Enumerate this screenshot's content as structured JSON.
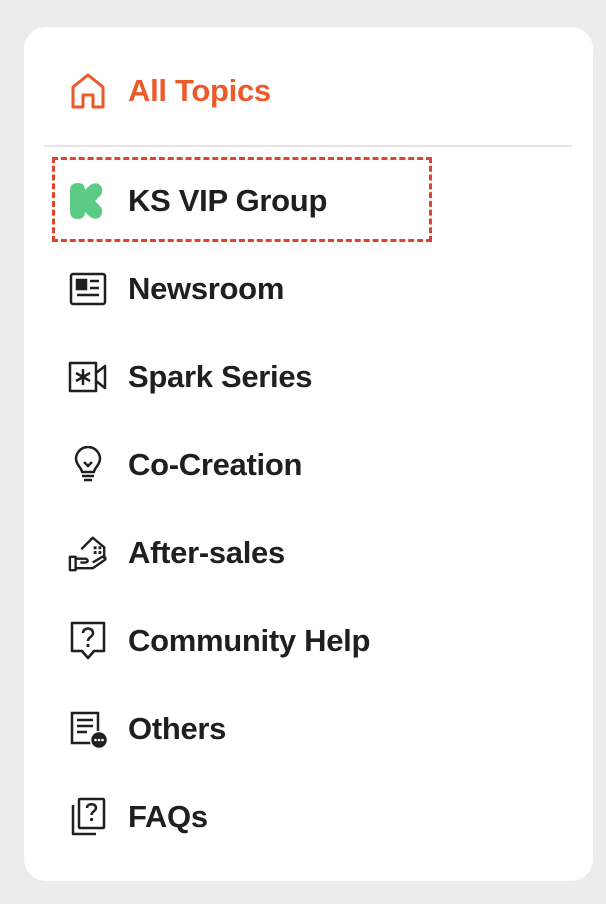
{
  "menu": {
    "all_topics": {
      "label": "All Topics",
      "icon": "home-icon",
      "color": "#ec5a2a"
    },
    "items": [
      {
        "label": "KS VIP Group",
        "icon": "ks-logo-icon",
        "color": "#5ccb86",
        "highlighted": true
      },
      {
        "label": "Newsroom",
        "icon": "newspaper-icon"
      },
      {
        "label": "Spark Series",
        "icon": "video-camera-icon"
      },
      {
        "label": "Co-Creation",
        "icon": "lightbulb-icon"
      },
      {
        "label": "After-sales",
        "icon": "hand-house-icon"
      },
      {
        "label": "Community Help",
        "icon": "question-bubble-icon"
      },
      {
        "label": "Others",
        "icon": "document-more-icon"
      },
      {
        "label": "FAQs",
        "icon": "question-cards-icon"
      }
    ]
  },
  "colors": {
    "accent": "#ec5a2a",
    "highlight_border": "#e0432a",
    "text": "#1f1f1f"
  }
}
